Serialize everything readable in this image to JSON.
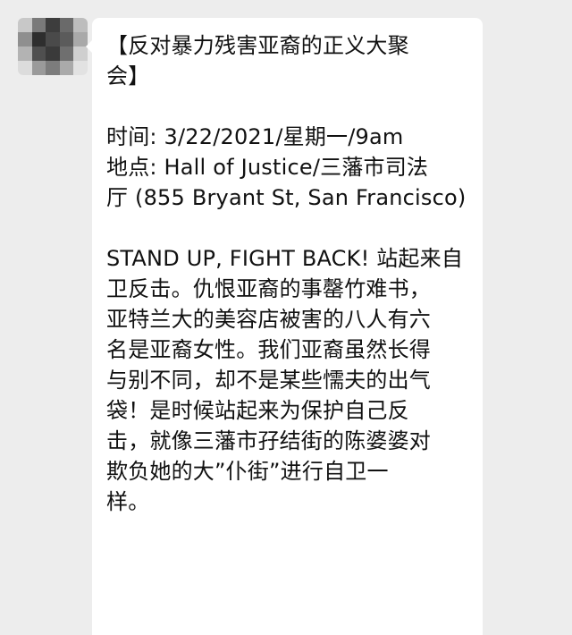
{
  "message": {
    "title_lines": [
      "【反对暴力残害亚裔的正义大聚",
      "会】"
    ],
    "info_lines": [
      "时间: 3/22/2021/星期一/9am",
      "地点: Hall of Justice/三藩市司法",
      "厅 (855 Bryant St, San Francisco)"
    ],
    "body_lines": [
      "STAND UP, FIGHT BACK! 站起来自",
      "卫反击。仇恨亚裔的事罄竹难书，",
      "亚特兰大的美容店被害的八人有六",
      "名是亚裔女性。我们亚裔虽然长得",
      "与别不同，却不是某些懦夫的出气",
      "袋！是时候站起来为保护自己反",
      "击，就像三藩市孖结街的陈婆婆对",
      "欺负她的大”仆街”进行自卫一",
      "样。"
    ]
  },
  "colors": {
    "background": "#ededed",
    "bubble": "#ffffff",
    "text": "#111111"
  },
  "icons": {
    "avatar": "blurred-avatar"
  }
}
